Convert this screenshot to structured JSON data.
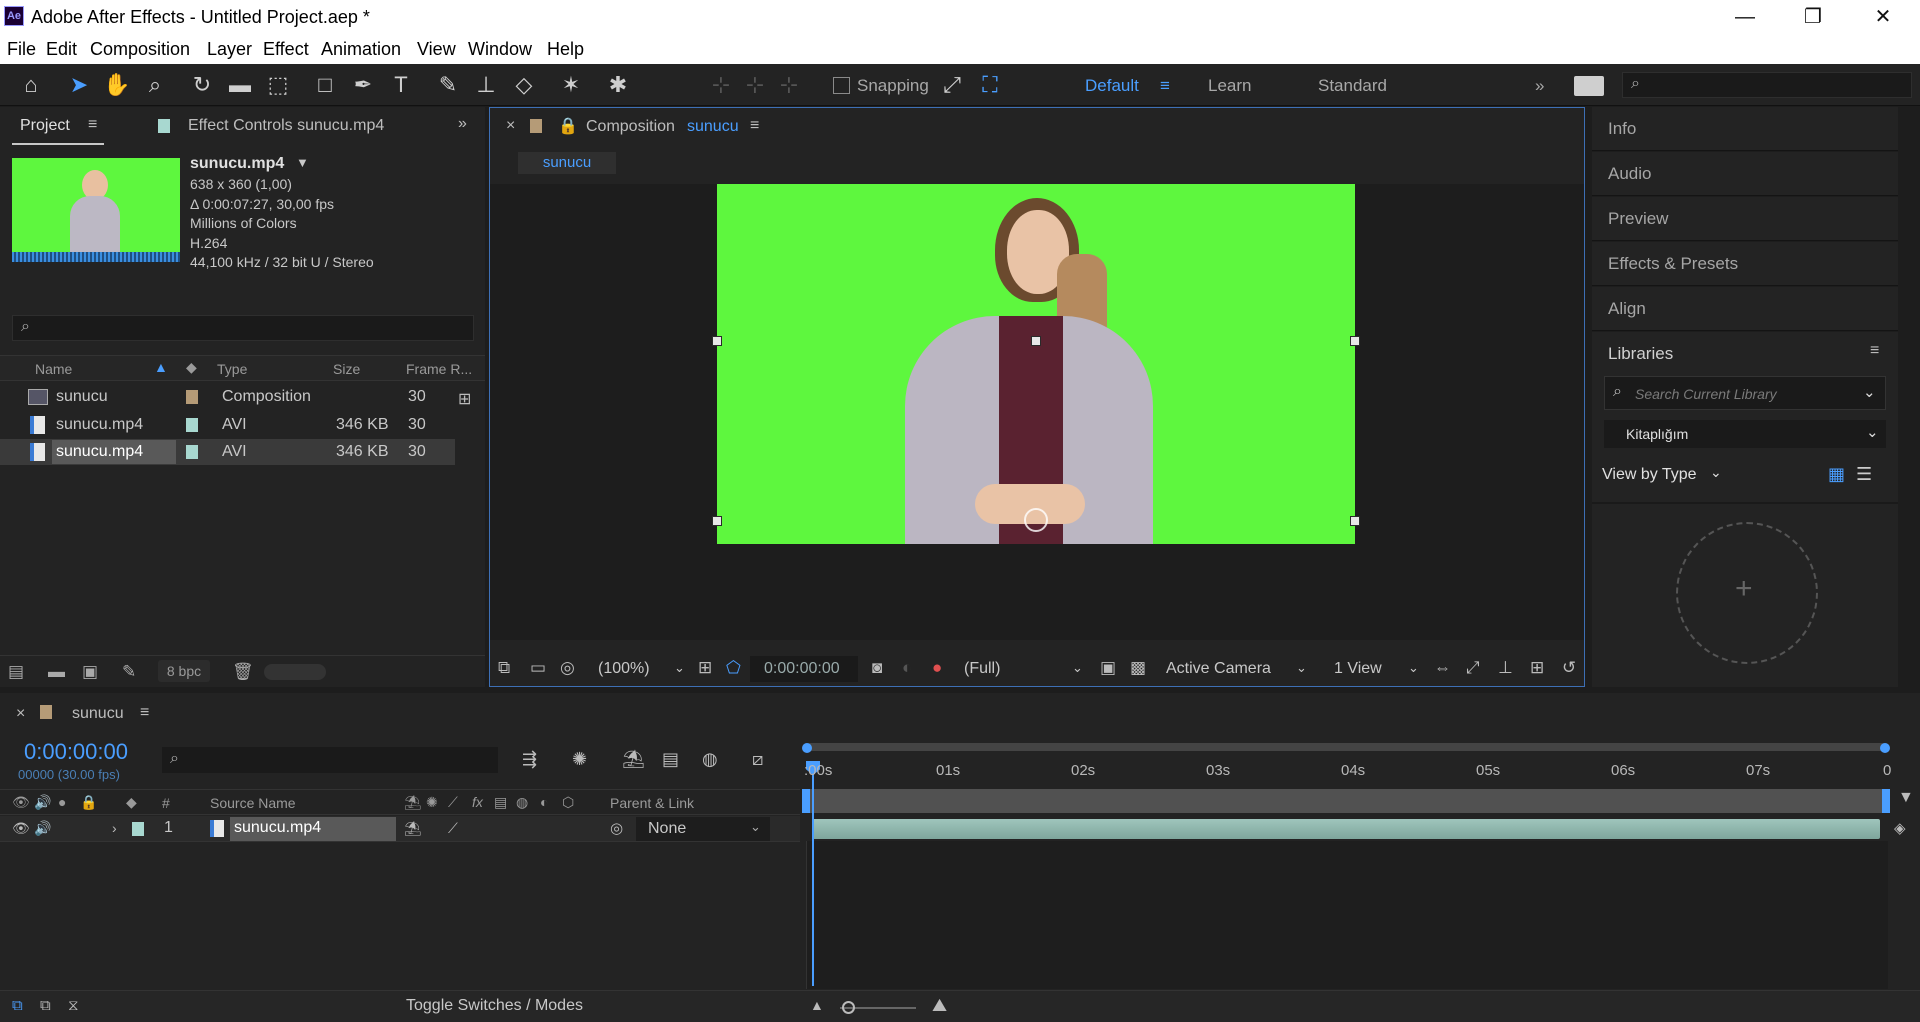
{
  "window": {
    "title": "Adobe After Effects - Untitled Project.aep *",
    "logo": "Ae"
  },
  "menu": [
    "File",
    "Edit",
    "Composition",
    "Layer",
    "Effect",
    "Animation",
    "View",
    "Window",
    "Help"
  ],
  "toolbar": {
    "snapping_label": "Snapping",
    "workspaces": [
      "Default",
      "Learn",
      "Standard"
    ],
    "active_workspace": "Default"
  },
  "project_panel": {
    "tabs": {
      "project": "Project",
      "effect_controls": "Effect Controls sunucu.mp4"
    },
    "preview": {
      "name": "sunucu.mp4",
      "resolution": "638 x 360 (1,00)",
      "duration": "Δ 0:00:07:27, 30,00 fps",
      "colors": "Millions of Colors",
      "codec": "H.264",
      "audio": "44,100 kHz / 32 bit U / Stereo"
    },
    "columns": {
      "name": "Name",
      "type": "Type",
      "size": "Size",
      "frame_rate": "Frame R..."
    },
    "items": [
      {
        "name": "sunucu",
        "type": "Composition",
        "size": "",
        "fps": "30",
        "label_color": "#b59b77"
      },
      {
        "name": "sunucu.mp4",
        "type": "AVI",
        "size": "346 KB",
        "fps": "30",
        "label_color": "#a8d8d0"
      },
      {
        "name": "sunucu.mp4",
        "type": "AVI",
        "size": "346 KB",
        "fps": "30",
        "label_color": "#a8d8d0"
      }
    ],
    "bpc": "8 bpc"
  },
  "composition_panel": {
    "tab_prefix": "Composition",
    "comp_name": "sunucu",
    "breadcrumb": "sunucu",
    "zoom": "(100%)",
    "timecode": "0:00:00:00",
    "resolution": "(Full)",
    "camera": "Active Camera",
    "views": "1 View"
  },
  "right_panel": {
    "items": [
      "Info",
      "Audio",
      "Preview",
      "Effects & Presets",
      "Align"
    ],
    "libraries": {
      "title": "Libraries",
      "search_placeholder": "Search Current Library",
      "library": "Kitaplığım",
      "view_by": "View by Type"
    }
  },
  "timeline": {
    "comp_name": "sunucu",
    "timecode": "0:00:00:00",
    "frame_info": "00000 (30.00 fps)",
    "columns": {
      "num": "#",
      "source_name": "Source Name",
      "parent": "Parent & Link"
    },
    "ruler": [
      ":00s",
      "01s",
      "02s",
      "03s",
      "04s",
      "05s",
      "06s",
      "07s",
      "0"
    ],
    "layer": {
      "index": "1",
      "name": "sunucu.mp4",
      "parent": "None"
    },
    "footer": "Toggle Switches / Modes"
  }
}
